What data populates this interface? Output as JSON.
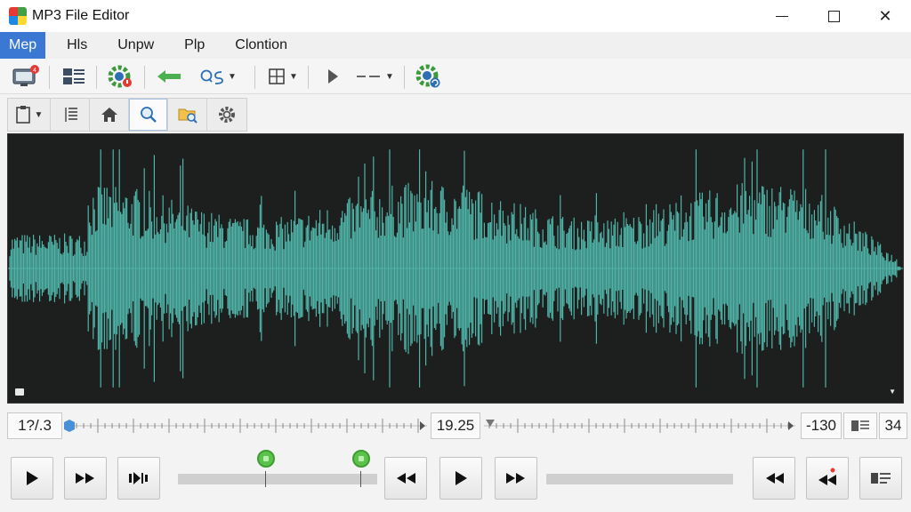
{
  "window": {
    "title": "MP3 File Editor"
  },
  "menu": {
    "items": [
      "Mep",
      "Hls",
      "Unpw",
      "Plp",
      "Clontion"
    ],
    "active_index": 0
  },
  "toolbar": {
    "items": [
      {
        "icon": "monitor-icon",
        "badge": "notification-badge"
      },
      {
        "icon": "grid-list-icon"
      },
      {
        "icon": "gear-refresh-icon"
      },
      {
        "icon": "arrow-left-icon"
      },
      {
        "icon": "search-q-icon",
        "label": "QS"
      },
      {
        "icon": "layout-icon"
      },
      {
        "icon": "play-icon"
      },
      {
        "icon": "line-style-icon",
        "label": "---"
      },
      {
        "icon": "gear-sync-icon"
      }
    ]
  },
  "toolbar2": {
    "items": [
      {
        "icon": "clipboard-icon"
      },
      {
        "icon": "list-view-icon"
      },
      {
        "icon": "home-icon"
      },
      {
        "icon": "zoom-icon",
        "active": true
      },
      {
        "icon": "folder-search-icon"
      },
      {
        "icon": "settings-icon"
      }
    ]
  },
  "waveform": {
    "color": "#4fb3a7",
    "background": "#1d1f1f"
  },
  "position_bar": {
    "left_readout": "1?/.3",
    "center_readout": "19.25",
    "right_readout": "-130",
    "far_right_readout": "34"
  },
  "transport": {
    "slider_left_knob_color": "#5cc34a",
    "buttons": [
      "play",
      "fast-forward",
      "skip-marker",
      "rewind",
      "play-center",
      "fast-forward-center",
      "rewind-right",
      "rewind-marker",
      "list-marker"
    ]
  }
}
